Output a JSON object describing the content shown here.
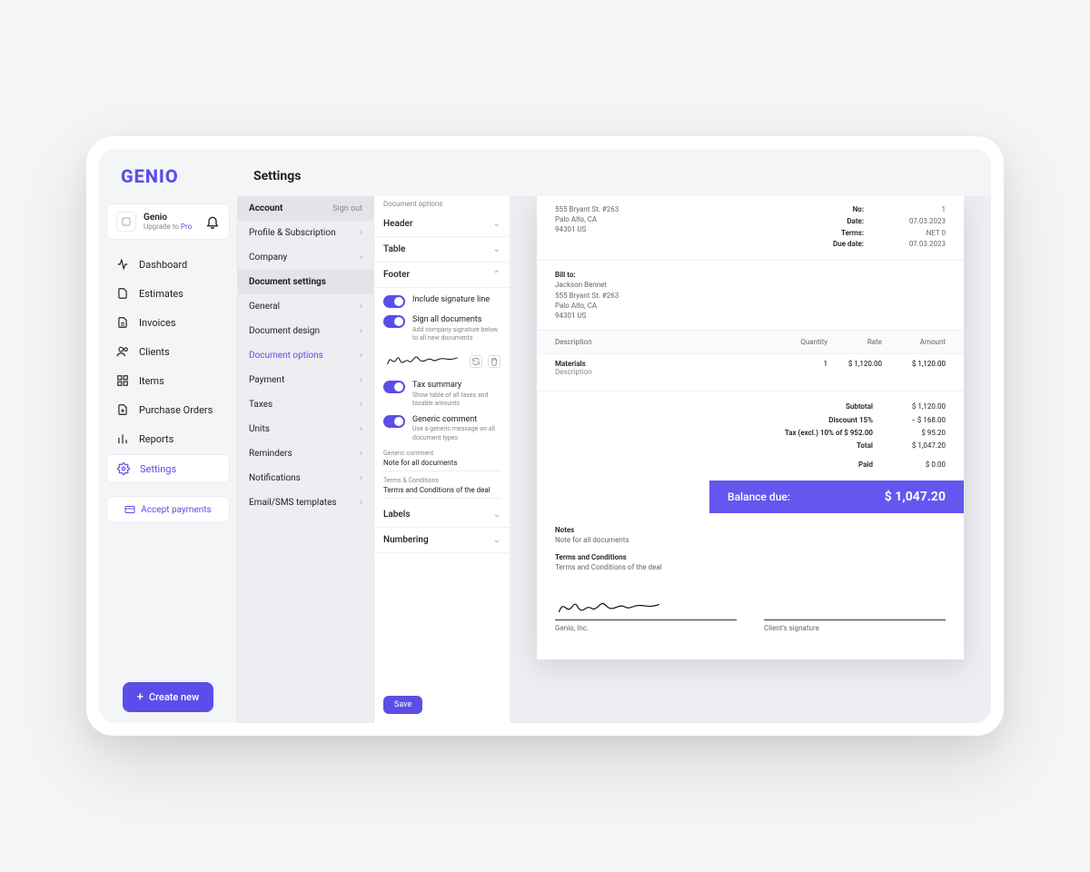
{
  "brand": "GENIO",
  "page_title": "Settings",
  "account": {
    "name": "Genio",
    "upgrade_prefix": "Upgrade to ",
    "upgrade_plan": "Pro"
  },
  "nav": {
    "dashboard": "Dashboard",
    "estimates": "Estimates",
    "invoices": "Invoices",
    "clients": "Clients",
    "items": "Items",
    "purchase_orders": "Purchase Orders",
    "reports": "Reports",
    "settings": "Settings"
  },
  "accept_payments": "Accept payments",
  "create_new": "Create new",
  "settings_panel": {
    "account_head": "Account",
    "sign_out": "Sign out",
    "profile": "Profile & Subscription",
    "company": "Company",
    "doc_head": "Document settings",
    "general": "General",
    "document_design": "Document design",
    "document_options": "Document options",
    "payment": "Payment",
    "taxes": "Taxes",
    "units": "Units",
    "reminders": "Reminders",
    "notifications": "Notifications",
    "templates": "Email/SMS templates"
  },
  "options": {
    "crumb": "Document options",
    "header": "Header",
    "table": "Table",
    "footer": "Footer",
    "labels": "Labels",
    "numbering": "Numbering",
    "include_signature": "Include signature line",
    "sign_all": "Sign all documents",
    "sign_all_sub": "Add company signature below to all new documents",
    "tax_summary": "Tax summary",
    "tax_summary_sub": "Show table of all taxes and taxable amounts",
    "generic_comment": "Generic comment",
    "generic_comment_sub": "Use a generic message on all document types",
    "gc_label": "Generic comment",
    "gc_value": "Note for all documents",
    "tc_label": "Terms & Conditions",
    "tc_value": "Terms and Conditions of the deal",
    "save": "Save"
  },
  "doc": {
    "addr1": "555 Bryant St. #263",
    "addr2": "Palo Alto, CA",
    "addr3": "94301 US",
    "no_lbl": "No:",
    "no_val": "1",
    "date_lbl": "Date:",
    "date_val": "07.03.2023",
    "terms_lbl": "Terms:",
    "terms_val": "NET 0",
    "due_lbl": "Due date:",
    "due_val": "07.03.2023",
    "billto_lbl": "Bill to:",
    "bill_name": "Jackson Bennet",
    "bill_addr1": "555 Bryant St. #263",
    "bill_addr2": "Palo Alto, CA",
    "bill_addr3": "94301 US",
    "col_desc": "Description",
    "col_qty": "Quantity",
    "col_rate": "Rate",
    "col_amt": "Amount",
    "item_name": "Materials",
    "item_desc": "Description",
    "item_qty": "1",
    "item_rate": "$ 1,120.00",
    "item_amt": "$ 1,120.00",
    "subtotal_lbl": "Subtotal",
    "subtotal_val": "$ 1,120.00",
    "disc_lbl": "Discount 15%",
    "disc_val": "− $ 168.00",
    "tax_lbl": "Tax (excl.) 10% of $ 952.00",
    "tax_val": "$ 95.20",
    "total_lbl": "Total",
    "total_val": "$ 1,047.20",
    "paid_lbl": "Paid",
    "paid_val": "$ 0.00",
    "balance_lbl": "Balance due:",
    "balance_val": "$ 1,047.20",
    "notes_head": "Notes",
    "notes_body": "Note for all documents",
    "terms_head": "Terms and Conditions",
    "terms_body": "Terms and Conditions of the deal",
    "sig_company": "Genio, Inc.",
    "sig_client": "Client's signature"
  }
}
